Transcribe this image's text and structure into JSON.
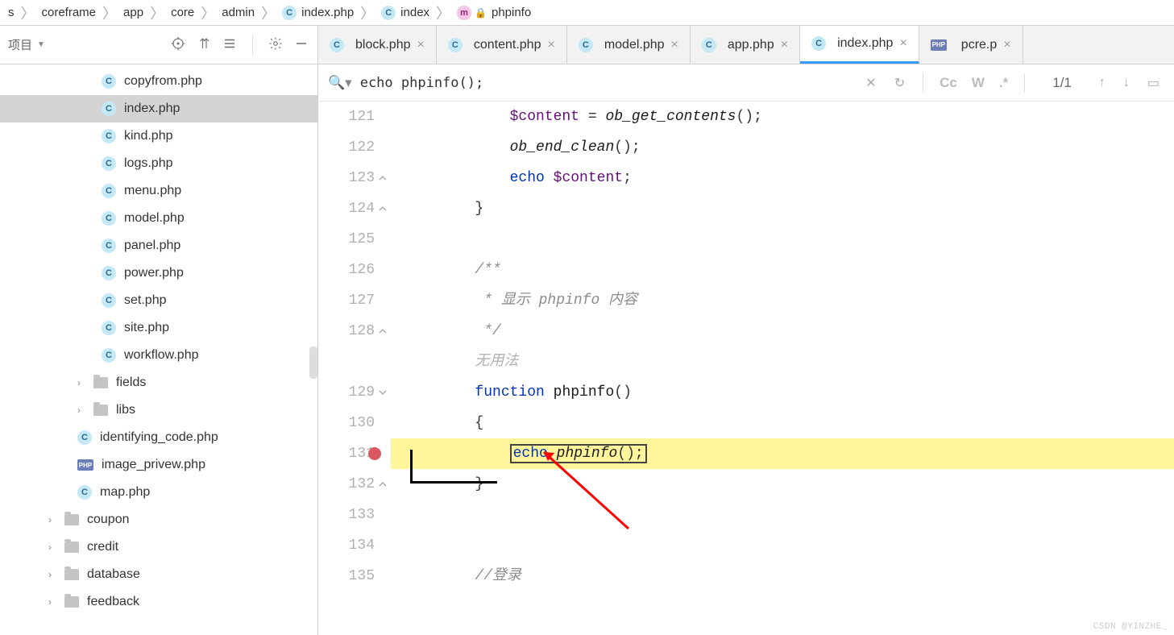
{
  "breadcrumb": [
    {
      "label": "s",
      "icon": null
    },
    {
      "label": "coreframe",
      "icon": null
    },
    {
      "label": "app",
      "icon": null
    },
    {
      "label": "core",
      "icon": null
    },
    {
      "label": "admin",
      "icon": null
    },
    {
      "label": "index.php",
      "icon": "c"
    },
    {
      "label": "index",
      "icon": "c"
    },
    {
      "label": "phpinfo",
      "icon": "m",
      "lock": true
    }
  ],
  "sidebar": {
    "project_label": "项目",
    "files": [
      {
        "name": "copyfrom.php",
        "type": "c",
        "indent": 0
      },
      {
        "name": "index.php",
        "type": "c",
        "indent": 0,
        "selected": true
      },
      {
        "name": "kind.php",
        "type": "c",
        "indent": 0
      },
      {
        "name": "logs.php",
        "type": "c",
        "indent": 0
      },
      {
        "name": "menu.php",
        "type": "c",
        "indent": 0
      },
      {
        "name": "model.php",
        "type": "c",
        "indent": 0
      },
      {
        "name": "panel.php",
        "type": "c",
        "indent": 0
      },
      {
        "name": "power.php",
        "type": "c",
        "indent": 0
      },
      {
        "name": "set.php",
        "type": "c",
        "indent": 0
      },
      {
        "name": "site.php",
        "type": "c",
        "indent": 0
      },
      {
        "name": "workflow.php",
        "type": "c",
        "indent": 0
      }
    ],
    "folders1": [
      {
        "name": "fields",
        "level": 2
      },
      {
        "name": "libs",
        "level": 2
      }
    ],
    "files2": [
      {
        "name": "identifying_code.php",
        "type": "c"
      },
      {
        "name": "image_privew.php",
        "type": "php"
      },
      {
        "name": "map.php",
        "type": "c"
      }
    ],
    "folders2": [
      {
        "name": "coupon"
      },
      {
        "name": "credit"
      },
      {
        "name": "database"
      },
      {
        "name": "feedback"
      }
    ]
  },
  "tabs": [
    {
      "label": "block.php",
      "icon": "c"
    },
    {
      "label": "content.php",
      "icon": "c"
    },
    {
      "label": "model.php",
      "icon": "c"
    },
    {
      "label": "app.php",
      "icon": "c"
    },
    {
      "label": "index.php",
      "icon": "c",
      "active": true
    },
    {
      "label": "pcre.p",
      "icon": "php"
    }
  ],
  "find": {
    "query": "echo phpinfo();",
    "count": "1/1",
    "cc": "Cc",
    "w": "W",
    "regex": ".*"
  },
  "code": {
    "lines": [
      {
        "n": 121,
        "html": "            <span class='var'>$content</span> = <span class='call'>ob_get_contents</span>();"
      },
      {
        "n": 122,
        "html": "            <span class='call'>ob_end_clean</span>();"
      },
      {
        "n": 123,
        "html": "            <span class='kw'>echo</span> <span class='var'>$content</span>;",
        "fold": "close"
      },
      {
        "n": 124,
        "html": "        }",
        "fold": "close"
      },
      {
        "n": 125,
        "html": ""
      },
      {
        "n": 126,
        "html": "        <span class='comment'>/**</span>"
      },
      {
        "n": 127,
        "html": "        <span class='comment'> * 显示 phpinfo 内容</span>"
      },
      {
        "n": 128,
        "html": "        <span class='comment'> */</span>",
        "fold": "close"
      },
      {
        "n": null,
        "html": "        <span class='gray-hint'>无用法</span>"
      },
      {
        "n": 129,
        "html": "        <span class='kw'>function</span> <span class='fn'>phpinfo</span>()",
        "fold": "open"
      },
      {
        "n": 130,
        "html": "        {"
      },
      {
        "n": 131,
        "html": "            <span class='echo-box'><span class='kw'>echo</span> <span class='call'>phpinfo</span>();</span>",
        "bp": true,
        "active": true
      },
      {
        "n": 132,
        "html": "        }",
        "fold": "close"
      },
      {
        "n": 133,
        "html": ""
      },
      {
        "n": 134,
        "html": ""
      },
      {
        "n": 135,
        "html": "        <span class='comment'>//登录</span>"
      }
    ]
  },
  "watermark": "CSDN @YINZHE_"
}
